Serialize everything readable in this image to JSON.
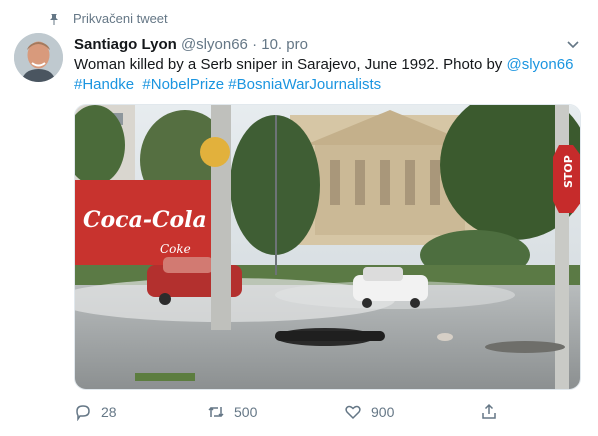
{
  "pinned_label": "Prikvačeni tweet",
  "tweet": {
    "author_name": "Santiago Lyon",
    "author_handle": "@slyon66",
    "separator": "·",
    "date": "10. pro",
    "text_main": "Woman killed by a Serb sniper in Sarajevo, June 1992. Photo by ",
    "text_mention": "@slyon66",
    "hashtags": [
      "#Handke",
      "#NobelPrize",
      "#BosniaWarJournalists"
    ]
  },
  "photo": {
    "sign_text": "Coca-Cola",
    "sign_subtext": "Coke",
    "stop_text": "STOP"
  },
  "actions": {
    "reply_count": "28",
    "retweet_count": "500",
    "like_count": "900"
  },
  "colors": {
    "link": "#1b95e0",
    "secondary_text": "#657786",
    "primary_text": "#14171a"
  },
  "icons": [
    "pin-icon",
    "chevron-down-icon",
    "reply-icon",
    "retweet-icon",
    "like-icon",
    "share-icon"
  ]
}
